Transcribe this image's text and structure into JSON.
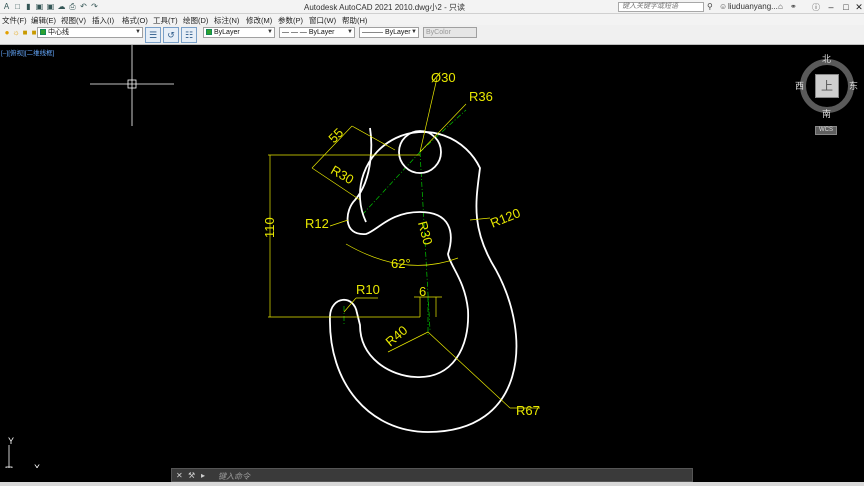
{
  "titlebar": {
    "app_title": "Autodesk AutoCAD 2021    2010.dwg小2 - 只读",
    "search_placeholder": "键入关键字或短语",
    "username": "liuduanyang...",
    "minimize": "–",
    "maximize": "□",
    "close": "✕"
  },
  "menu": {
    "items": [
      "文件(F)",
      "编辑(E)",
      "视图(V)",
      "插入(I)",
      "格式(O)",
      "工具(T)",
      "绘图(D)",
      "标注(N)",
      "修改(M)",
      "参数(P)",
      "窗口(W)",
      "帮助(H)"
    ]
  },
  "toolbar": {
    "layer_name": "中心线",
    "color": "ByLayer",
    "linetype": "— — — ByLayer",
    "lineweight": "——— ByLayer",
    "plotstyle": "ByColor"
  },
  "viewport": {
    "label": "[–][俯视][二维线框]"
  },
  "drawing": {
    "dimensions": {
      "dia30": "Ø30",
      "r36": "R36",
      "d55": "55",
      "r30_upper": "R30",
      "r12": "R12",
      "r30_inner": "R30",
      "r120": "R120",
      "d110": "110",
      "a62": "62°",
      "r10": "R10",
      "d6": "6",
      "r40": "R40",
      "r67": "R67"
    },
    "ucs": {
      "x": "X",
      "y": "Y"
    },
    "colors": {
      "geometry": "#ffffff",
      "dimension": "#e8e800",
      "centerline": "#00c800",
      "background": "#000000"
    }
  },
  "viewcube": {
    "north": "北",
    "south": "南",
    "east": "东",
    "west": "西",
    "face": "上",
    "wcs": "WCS"
  },
  "command_line": {
    "placeholder": "键入命令"
  }
}
